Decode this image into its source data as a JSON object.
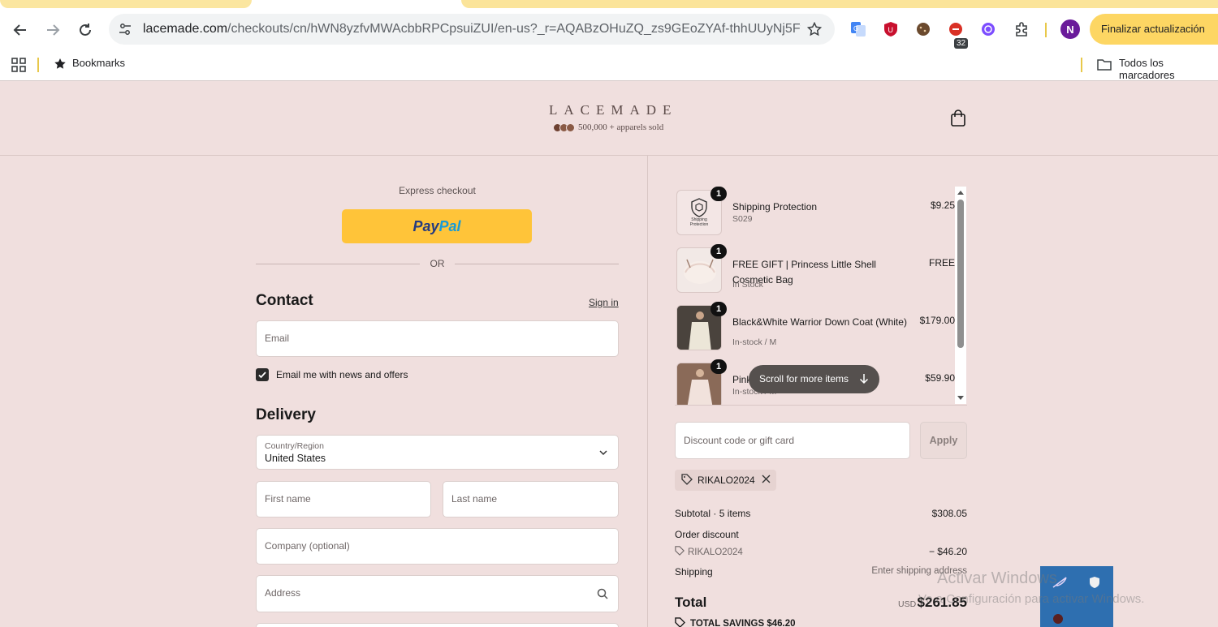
{
  "browser": {
    "url_host": "lacemade.com",
    "url_path": "/checkouts/cn/hWN8yzfvMWAcbbRPCpsuiZUI/en-us?_r=AQABzOHuZQ_zs9GEoZYAf-thhUUyNj5Fv8s...",
    "extension_badge": "32",
    "profile_initial": "N",
    "update_label": "Finalizar actualización",
    "bookmarks_label": "Bookmarks",
    "all_bookmarks_label": "Todos los marcadores"
  },
  "header": {
    "logo": "LACEMADE",
    "sold_text": "500,000 + apparels sold"
  },
  "checkout": {
    "express_label": "Express checkout",
    "paypal_pay": "Pay",
    "paypal_pal": "Pal",
    "or_text": "OR",
    "contact_title": "Contact",
    "sign_in": "Sign in",
    "email_placeholder": "Email",
    "newsletter_label": "Email me with news and offers",
    "newsletter_checked": true,
    "delivery_title": "Delivery",
    "country_label": "Country/Region",
    "country_value": "United States",
    "first_name_placeholder": "First name",
    "last_name_placeholder": "Last name",
    "company_placeholder": "Company (optional)",
    "address_placeholder": "Address"
  },
  "order": {
    "items": [
      {
        "qty": "1",
        "name": "Shipping Protection",
        "sub": "S029",
        "price": "$9.25",
        "thumb_text": "Shipping Protection"
      },
      {
        "qty": "1",
        "name": "FREE GIFT | Princess Little Shell Cosmetic Bag",
        "sub": "In Stock",
        "price": "FREE"
      },
      {
        "qty": "1",
        "name": "Black&White Warrior Down Coat (White)",
        "sub": "In-stock / M",
        "price": "$179.00"
      },
      {
        "qty": "1",
        "name": "Pink",
        "sub": "In-stock / M",
        "price": "$59.90"
      }
    ],
    "scroll_hint": "Scroll for more items",
    "discount_placeholder": "Discount code or gift card",
    "apply_label": "Apply",
    "applied_code": "RIKALO2024",
    "subtotal_label": "Subtotal · 5 items",
    "subtotal_value": "$308.05",
    "order_discount_label": "Order discount",
    "discount_code_line": "RIKALO2024",
    "discount_value": "− $46.20",
    "shipping_label": "Shipping",
    "shipping_value": "Enter shipping address",
    "total_label": "Total",
    "total_currency": "USD",
    "total_value": "$261.85",
    "savings_text": "TOTAL SAVINGS  $46.20"
  },
  "overlay": {
    "activate_title": "Activar Windows",
    "activate_sub": "Ve a Configuración para activar Windows."
  }
}
